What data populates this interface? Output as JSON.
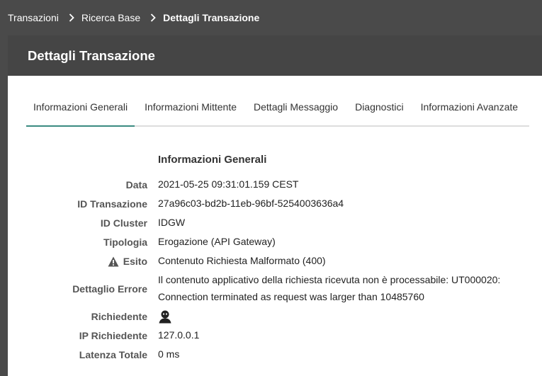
{
  "breadcrumb": {
    "items": [
      "Transazioni",
      "Ricerca Base",
      "Dettagli Transazione"
    ]
  },
  "panel": {
    "title": "Dettagli Transazione"
  },
  "tabs": [
    {
      "label": "Informazioni Generali",
      "active": true
    },
    {
      "label": "Informazioni Mittente",
      "active": false
    },
    {
      "label": "Dettagli Messaggio",
      "active": false
    },
    {
      "label": "Diagnostici",
      "active": false
    },
    {
      "label": "Informazioni Avanzate",
      "active": false
    }
  ],
  "section": {
    "title": "Informazioni Generali",
    "fields": {
      "data": {
        "label": "Data",
        "value": "2021-05-25 09:31:01.159 CEST"
      },
      "id_transazione": {
        "label": "ID Transazione",
        "value": "27a96c03-bd2b-11eb-96bf-5254003636a4"
      },
      "id_cluster": {
        "label": "ID Cluster",
        "value": "IDGW"
      },
      "tipologia": {
        "label": "Tipologia",
        "value": "Erogazione (API Gateway)"
      },
      "esito": {
        "label": "Esito",
        "value": "Contenuto Richiesta Malformato (400)",
        "icon": "warning-icon"
      },
      "dettaglio_errore": {
        "label": "Dettaglio Errore",
        "line1": "Il contenuto applicativo della richiesta ricevuta non è processabile: UT000020:",
        "line2": "Connection terminated as request was larger than 10485760"
      },
      "richiedente": {
        "label": "Richiedente",
        "icon": "anonymous-user-icon"
      },
      "ip_richiedente": {
        "label": "IP Richiedente",
        "value": "127.0.0.1"
      },
      "latenza_totale": {
        "label": "Latenza Totale",
        "value": "0 ms"
      }
    }
  },
  "colors": {
    "header_bg": "#454545",
    "page_bg": "#4a4a4a",
    "active_tab": "#3a8a80"
  }
}
